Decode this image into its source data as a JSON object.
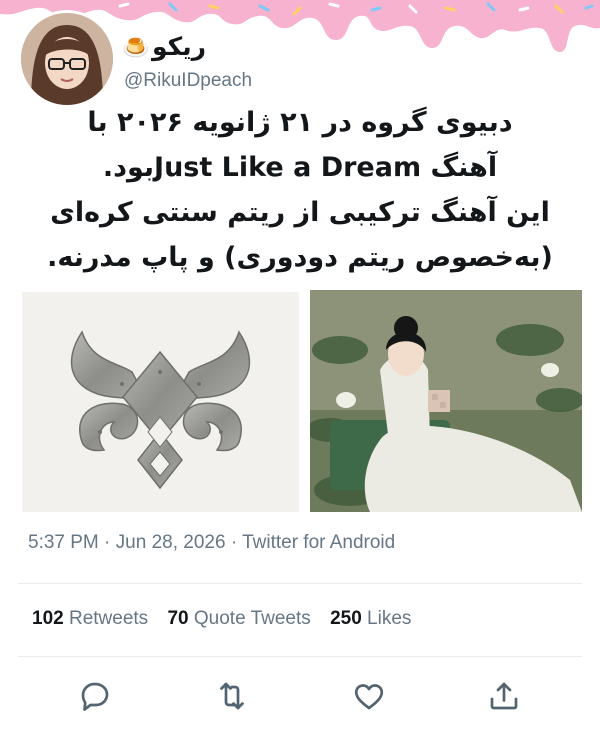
{
  "author": {
    "display_name": "ريكو",
    "display_emoji": "🍮",
    "handle": "@RikuIDpeach"
  },
  "tweet": {
    "lines": [
      "دبیوی گروه در ۲۱ ژانویه ۲۰۲۶ با",
      "آهنگ Just Like a Dreamبود.",
      "این آهنگ ترکیبی از ریتم سنتی کره‌ای",
      "(به‌خصوص ریتم دودوری) و پاپ مدرنه."
    ]
  },
  "meta": {
    "time": "5:37 PM",
    "separator": "·",
    "date": "Jun 28, 2026",
    "source": "Twitter for Android"
  },
  "stats": {
    "retweets_count": "102",
    "retweets_label": "Retweets",
    "quotes_count": "70",
    "quotes_label": "Quote Tweets",
    "likes_count": "250",
    "likes_label": "Likes"
  },
  "icons": [
    "reply-icon",
    "retweet-icon",
    "like-icon",
    "share-icon"
  ],
  "colors": {
    "drip": "#f6b2cf",
    "secondary_text": "#657786",
    "icon": "#536471"
  }
}
